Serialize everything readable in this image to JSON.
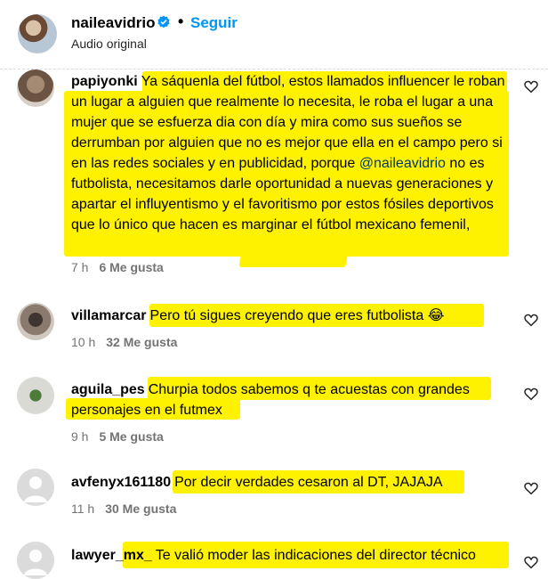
{
  "header": {
    "username": "naileavidrio",
    "separator": "•",
    "follow_label": "Seguir",
    "subtitle": "Audio original"
  },
  "colors": {
    "highlight": "#fff200",
    "link": "#0095f6",
    "mention": "#00376b",
    "meta": "#737373"
  },
  "comments": [
    {
      "username": "papiyonki",
      "text_part1": "Ya sáquenla del fútbol, estos llamados influencer le roban un lugar a alguien que realmente lo necesita, le roba el lugar a una mujer que se esfuerza dia con día y mira como sus sueños se derrumban por alguien que no es mejor que ella en el campo pero si en las redes sociales y en publicidad, porque",
      "mention": "@naileavidrio",
      "text_part2": "no es futbolista, necesitamos darle oportunidad a nuevas generaciones y apartar el influyentismo y el favoritismo por estos fósiles deportivos que lo único que hacen es marginar el fútbol mexicano femenil,",
      "time": "7 h",
      "likes": "6 Me gusta"
    },
    {
      "username": "villamarcar",
      "text": "Pero tú sigues creyendo que eres futbolista 😂",
      "time": "10 h",
      "likes": "32 Me gusta"
    },
    {
      "username": "aguila_pes",
      "text": "Churpia todos sabemos q te acuestas con grandes personajes en el futmex",
      "time": "9 h",
      "likes": "5 Me gusta"
    },
    {
      "username": "avfenyx161180",
      "text": "Por decir verdades cesaron al DT, JAJAJA",
      "time": "11 h",
      "likes": "30 Me gusta"
    },
    {
      "username": "lawyer_mx_",
      "text": "Te valió moder las indicaciones del director técnico"
    }
  ]
}
